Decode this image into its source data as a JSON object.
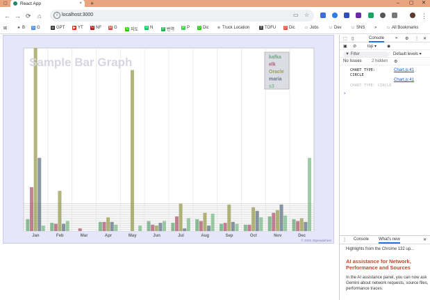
{
  "browser": {
    "tab_title": "React App",
    "tab_close": "×",
    "new_tab": "+",
    "window_controls": [
      "–",
      "▢",
      "✕"
    ],
    "url": "localhost:3000",
    "nav": [
      "←",
      "→",
      "⟳",
      "⌂"
    ],
    "bookmarks": [
      "B",
      "G",
      "GPT",
      "YT",
      "NF",
      "G",
      "지도",
      "N",
      "번역",
      "P",
      "Dic",
      "Truck Location",
      "TOFU",
      "Dic",
      "Jobs",
      "Dev",
      "SNS"
    ],
    "bookmarks_more": "»",
    "all_bookmarks": "All Bookmarks",
    "colors": {
      "titlebar": "#e8a57f",
      "tab_favicon": "#1a8a6e"
    }
  },
  "chart_data": {
    "type": "bar",
    "title": "Sample Bar Graph",
    "categories": [
      "Jan",
      "Feb",
      "Mar",
      "Apr",
      "May",
      "Jun",
      "Jul",
      "Aug",
      "Sep",
      "Oct",
      "Nov",
      "Dec"
    ],
    "ylim": [
      0,
      1000
    ],
    "grid": true,
    "legend_placement": "top-right",
    "legend": [
      "kafka",
      "elk",
      "Oracle",
      "maria",
      "s3"
    ],
    "series": [
      {
        "name": "kafka",
        "color": "#4f9c64",
        "values": [
          65,
          45,
          0,
          50,
          0,
          55,
          45,
          65,
          40,
          35,
          80,
          65
        ]
      },
      {
        "name": "elk",
        "color": "#a4405a",
        "values": [
          240,
          40,
          15,
          50,
          0,
          35,
          80,
          55,
          45,
          35,
          100,
          55
        ]
      },
      {
        "name": "Oracle",
        "color": "#8a8f35",
        "values": [
          1000,
          220,
          0,
          75,
          880,
          30,
          150,
          100,
          145,
          130,
          115,
          70
        ]
      },
      {
        "name": "maria",
        "color": "#4b5f73",
        "values": [
          400,
          40,
          0,
          50,
          0,
          45,
          15,
          30,
          50,
          110,
          145,
          50
        ]
      },
      {
        "name": "s3",
        "color": "#6ab07a",
        "values": [
          30,
          55,
          0,
          35,
          30,
          55,
          70,
          95,
          40,
          75,
          85,
          400
        ]
      }
    ],
    "copyright": "© 2020 JSpreadsheet"
  },
  "devtools": {
    "tabs": [
      "Console",
      "»"
    ],
    "context": "top ▾",
    "filter_placeholder": "Filter",
    "levels": "Default levels ▾",
    "no_issues": "No Issues",
    "hidden": "2 hidden",
    "logs": [
      {
        "msg": "CHART TYPE: CIRCLE",
        "source": "Chart.js:41"
      },
      {
        "msg": "CHART TYPE: CIRCLE",
        "source": "Chart.js:41",
        "faint": true
      }
    ],
    "prompt": "›",
    "drawer_tabs": [
      "Console",
      "What's new"
    ],
    "highlights": "Highlights from the Chrome 132 up...",
    "whats_new_title": "AI assistance for Network, Performance and Sources",
    "whats_new_body": "In the AI assistance panel, you can now ask Gemini about network requests, source files, performance traces."
  }
}
